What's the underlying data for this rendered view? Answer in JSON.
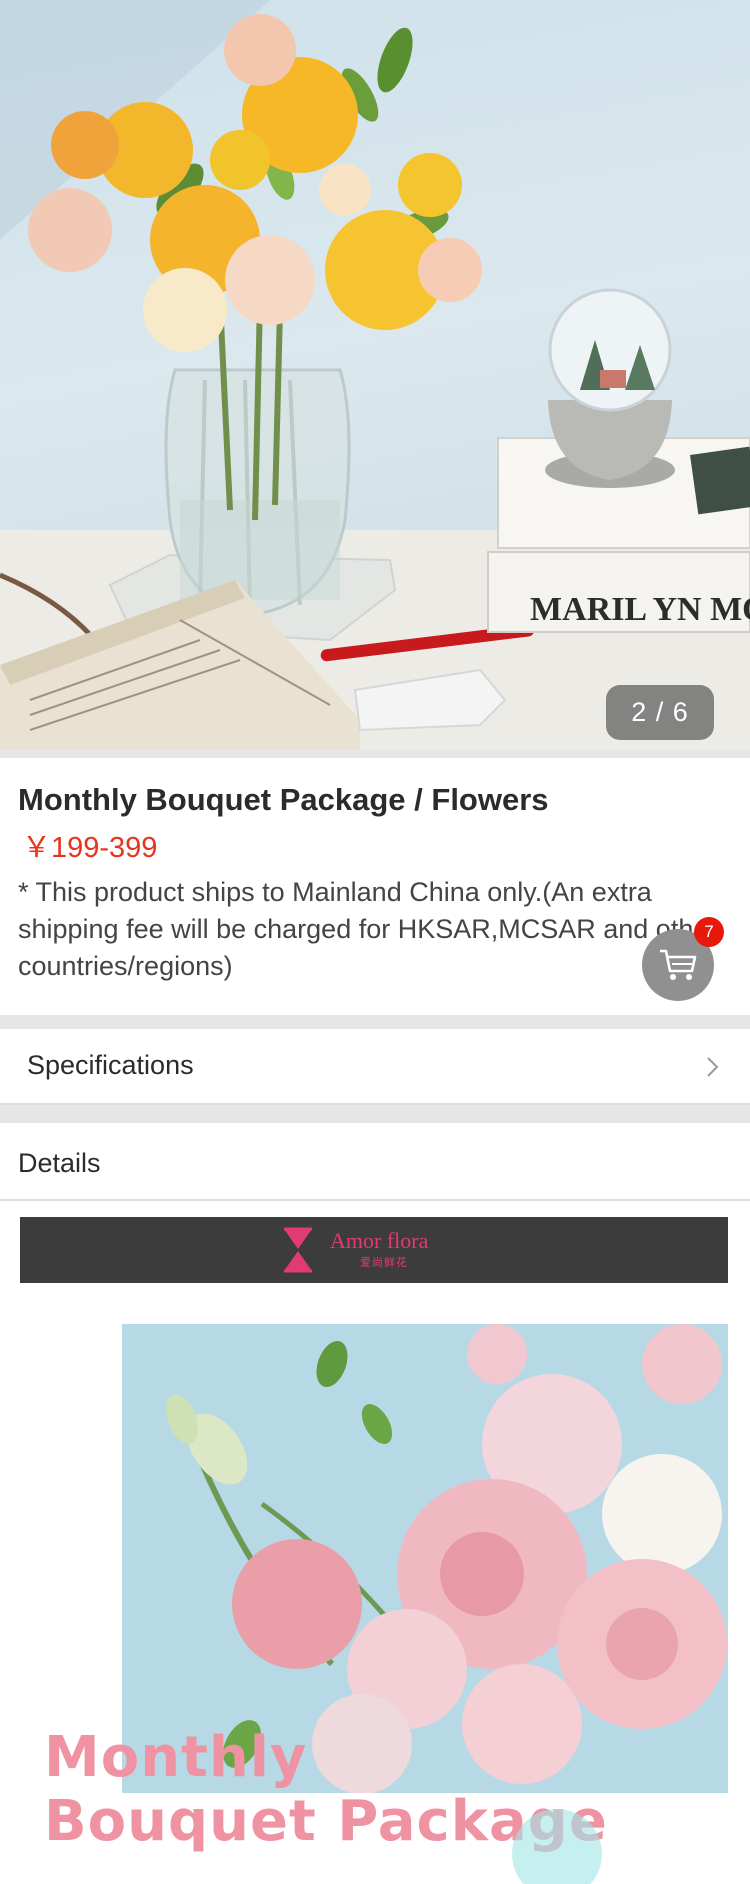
{
  "hero": {
    "image_index": "2 / 6",
    "book_spine_text": "MARIL YN MO"
  },
  "product": {
    "title": "Monthly Bouquet Package / Flowers",
    "price": "￥199-399",
    "note": "* This product ships to Mainland China only.(An extra shipping fee will be charged for HKSAR,MCSAR and other countries/regions)"
  },
  "cart": {
    "icon": "cart-icon",
    "badge_count": "7"
  },
  "specifications": {
    "label": "Specifications",
    "icon": "chevron-right-icon"
  },
  "details": {
    "label": "Details",
    "brand_name": "Amor flora",
    "brand_sub": "爱尚鲜花",
    "overlay_line1": "Monthly",
    "overlay_line2": "Bouquet Package"
  },
  "colors": {
    "price": "#e8341c",
    "badge": "#e8190c",
    "brand_accent": "#e23a72",
    "overlay_text": "#ef93a2",
    "divider": "#e6e6e6"
  }
}
